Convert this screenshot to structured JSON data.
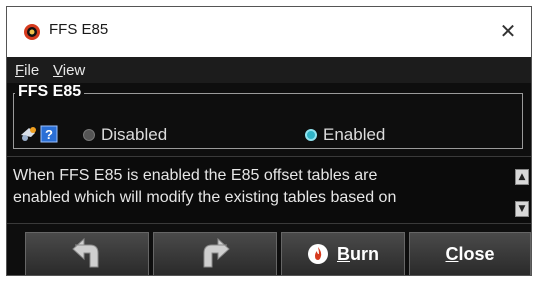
{
  "window": {
    "title": "FFS E85",
    "close_glyph": "✕"
  },
  "menu": {
    "file_first": "F",
    "file_rest": "ile",
    "view_first": "V",
    "view_rest": "iew"
  },
  "group": {
    "title": "FFS E85",
    "options": [
      {
        "label": "Disabled",
        "selected": false
      },
      {
        "label": "Enabled",
        "selected": true
      }
    ]
  },
  "description": {
    "line1": "When FFS E85 is enabled the E85 offset tables are",
    "line2": "enabled which will modify the existing tables based on"
  },
  "toolbar": {
    "undo_icon": "undo-arrow-icon",
    "redo_icon": "redo-arrow-icon",
    "burn_first": "B",
    "burn_rest": "urn",
    "close_first": "C",
    "close_rest": "lose"
  },
  "colors": {
    "accent_radio": "#2fb3c7",
    "app_icon": "#d63b1f"
  }
}
